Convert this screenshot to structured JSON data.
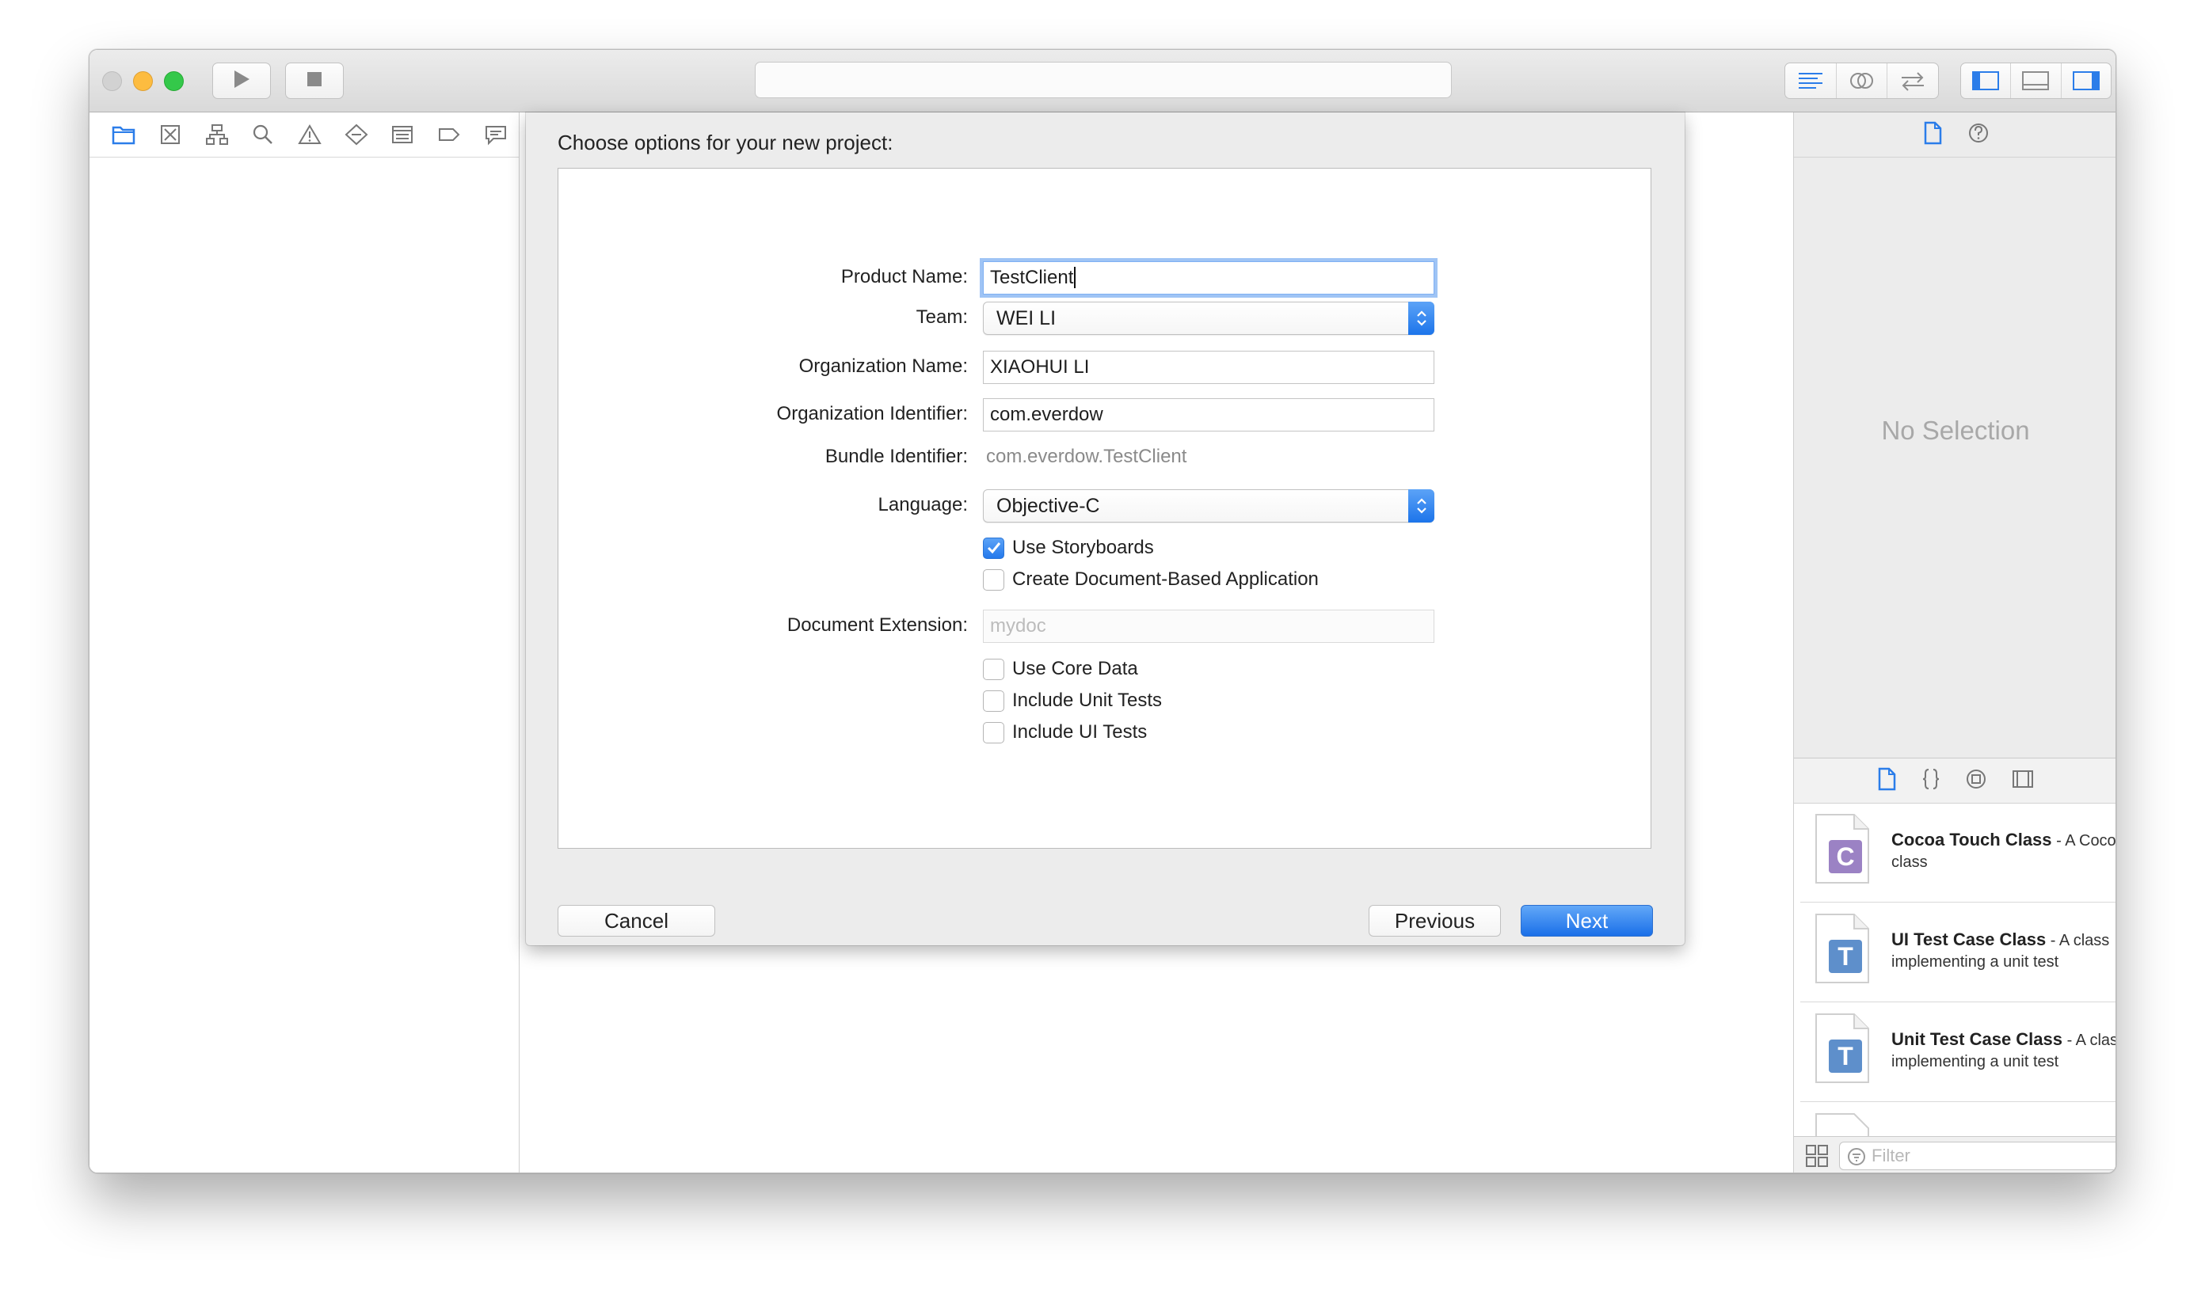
{
  "toolbar": {
    "run_icon": "play-icon",
    "stop_icon": "stop-icon",
    "editor_modes": [
      "standard-editor-icon",
      "assistant-editor-icon",
      "version-editor-icon"
    ],
    "panel_toggles": [
      "navigator-toggle-icon",
      "debug-area-toggle-icon",
      "utilities-toggle-icon"
    ],
    "activity_text": ""
  },
  "navigator": {
    "tabs": [
      "project-navigator-icon",
      "source-control-icon",
      "symbol-navigator-icon",
      "find-navigator-icon",
      "issue-navigator-icon",
      "test-navigator-icon",
      "debug-navigator-icon",
      "breakpoint-navigator-icon",
      "report-navigator-icon"
    ]
  },
  "dialog": {
    "title": "Choose options for your new project:",
    "fields": {
      "product_name_label": "Product Name:",
      "product_name_value": "TestClient",
      "team_label": "Team:",
      "team_value": "WEI LI",
      "org_name_label": "Organization Name:",
      "org_name_value": "XIAOHUI LI",
      "org_id_label": "Organization Identifier:",
      "org_id_value": "com.everdow",
      "bundle_id_label": "Bundle Identifier:",
      "bundle_id_value": "com.everdow.TestClient",
      "language_label": "Language:",
      "language_value": "Objective-C",
      "doc_ext_label": "Document Extension:",
      "doc_ext_placeholder": "mydoc"
    },
    "checkboxes": {
      "storyboards": {
        "label": "Use Storyboards",
        "checked": true
      },
      "document_based": {
        "label": "Create Document-Based Application",
        "checked": false
      },
      "core_data": {
        "label": "Use Core Data",
        "checked": false
      },
      "unit_tests": {
        "label": "Include Unit Tests",
        "checked": false
      },
      "ui_tests": {
        "label": "Include UI Tests",
        "checked": false
      }
    },
    "buttons": {
      "cancel": "Cancel",
      "previous": "Previous",
      "next": "Next"
    }
  },
  "inspector": {
    "tabs": [
      "file-inspector-icon",
      "quick-help-icon"
    ],
    "empty_text": "No Selection"
  },
  "library": {
    "tabs": [
      "file-template-library-icon",
      "code-snippet-library-icon",
      "object-library-icon",
      "media-library-icon"
    ],
    "items": [
      {
        "title": "Cocoa Touch Class",
        "desc": " - A Cocoa Touch class",
        "icon_letter": "C",
        "color": "#9b82c4"
      },
      {
        "title": "UI Test Case Class",
        "desc": " - A class implementing a unit test",
        "icon_letter": "T",
        "color": "#5e8fcb"
      },
      {
        "title": "Unit Test Case Class",
        "desc": " - A class implementing a unit test",
        "icon_letter": "T",
        "color": "#5e8fcb"
      }
    ],
    "filter_placeholder": "Filter"
  },
  "colors": {
    "accent": "#1a73e8",
    "focus_ring": "#8cb9f5",
    "traffic_red": "#fc605c",
    "traffic_yellow": "#fdbc40",
    "traffic_green": "#34c84a"
  }
}
